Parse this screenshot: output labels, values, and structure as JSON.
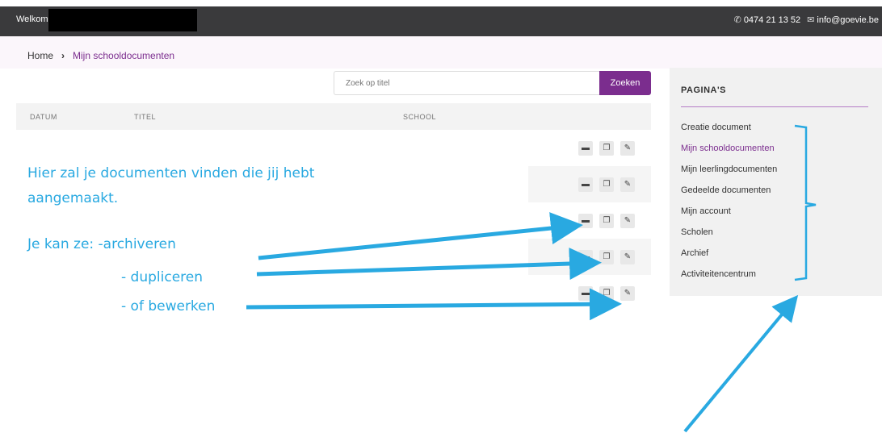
{
  "header": {
    "welcome": "Welkom,",
    "phone": "0474 21 13 52",
    "email": "info@goevie.be"
  },
  "breadcrumb": {
    "home": "Home",
    "separator": "›",
    "current": "Mijn schooldocumenten"
  },
  "search": {
    "placeholder": "Zoek op titel",
    "button": "Zoeken"
  },
  "table": {
    "columns": [
      "DATUM",
      "TITEL",
      "SCHOOL"
    ],
    "row_count": 5
  },
  "sidebar": {
    "title": "PAGINA'S",
    "items": [
      {
        "label": "Creatie document"
      },
      {
        "label": "Mijn schooldocumenten",
        "active": true
      },
      {
        "label": "Mijn leerlingdocumenten"
      },
      {
        "label": "Gedeelde documenten"
      },
      {
        "label": "Mijn account"
      },
      {
        "label": "Scholen"
      },
      {
        "label": "Archief"
      },
      {
        "label": "Activiteitencentrum"
      }
    ]
  },
  "annotations": {
    "line1": "Hier zal je documenten vinden die jij hebt",
    "line2": "aangemaakt.",
    "line3": "Je kan ze: -archiveren",
    "line4": "- dupliceren",
    "line5": "- of bewerken"
  },
  "colors": {
    "accent": "#7b2d8e",
    "annotation": "#29a9e1",
    "topbar": "#3a3a3c"
  },
  "icons": {
    "phone": "phone-icon",
    "email": "envelope-icon",
    "archive": "archive-icon",
    "duplicate": "copy-icon",
    "edit": "edit-icon"
  }
}
